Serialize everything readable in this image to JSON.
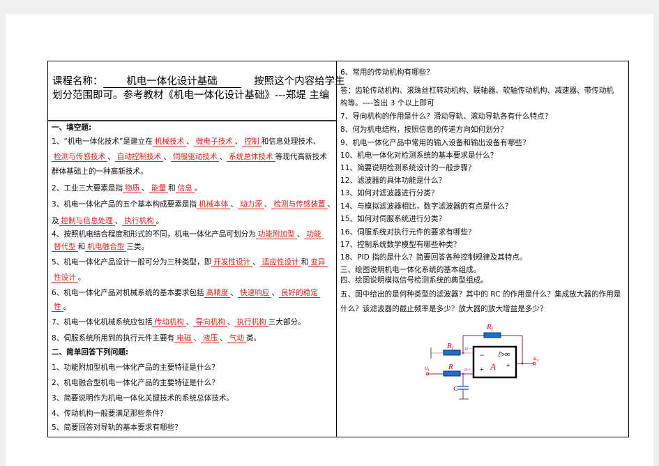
{
  "header": {
    "label": "课程名称：",
    "course": "机电一体化设计基础",
    "line1_tail": "按照这个内容给学生",
    "line2": "划分范围即可。参考教材《机电一体化设计基础》---郑堤  主编"
  },
  "left_lines": [
    [
      {
        "t": "一、填空题:",
        "bold": true
      }
    ],
    [
      {
        "t": "1、“机电一体化技术”是建立在"
      },
      {
        "t": "机械技术",
        "blank": true
      },
      {
        "t": "、"
      },
      {
        "t": "微电子技术",
        "blank": true
      },
      {
        "t": "、"
      },
      {
        "t": "控制",
        "blank": true
      },
      {
        "t": "和信息处理技术、"
      }
    ],
    [
      {
        "t": "检测与传感技术",
        "blank": true
      },
      {
        "t": "、"
      },
      {
        "t": "自动控制技术",
        "blank": true
      },
      {
        "t": "、"
      },
      {
        "t": "伺服驱动技术",
        "blank": true
      },
      {
        "t": "、"
      },
      {
        "t": "系统总体技术",
        "blank": true
      },
      {
        "t": "等现代高新技术"
      }
    ],
    [
      {
        "t": "群体基础上的一种高新技术。"
      }
    ],
    [
      {
        "t": "2、工业三大要素是指"
      },
      {
        "t": "物质",
        "blank": true
      },
      {
        "t": "、"
      },
      {
        "t": "能量",
        "blank": true
      },
      {
        "t": "和"
      },
      {
        "t": "信息",
        "blank": true
      },
      {
        "t": "。"
      }
    ],
    [
      {
        "t": "3、机电一体化产品的五个基本构成要素是指"
      },
      {
        "t": "机械本体",
        "blank": true
      },
      {
        "t": "、"
      },
      {
        "t": "动力源",
        "blank": true
      },
      {
        "t": "、"
      },
      {
        "t": "检测与传感装置",
        "blank": true
      },
      {
        "t": "、"
      }
    ],
    [
      {
        "t": "及"
      },
      {
        "t": "控制与信息处理",
        "blank": true
      },
      {
        "t": "、"
      },
      {
        "t": "执行机构",
        "blank": true
      },
      {
        "t": "。"
      }
    ],
    [
      {
        "t": "4、按照机电结合程度和形式的不同，机电一体化产品可划分为"
      },
      {
        "t": "功能附加型",
        "blank": true
      },
      {
        "t": "、"
      },
      {
        "t": "功能",
        "blank": true
      }
    ],
    [
      {
        "t": "替代型",
        "blank": true
      },
      {
        "t": "和"
      },
      {
        "t": "机电融合型",
        "blank": true
      },
      {
        "t": "三类。"
      }
    ],
    [
      {
        "t": "5、机电一体化产品设计一般可分为三种类型，即"
      },
      {
        "t": "开发性设计",
        "blank": true
      },
      {
        "t": "、"
      },
      {
        "t": "适应性设计",
        "blank": true
      },
      {
        "t": "和"
      },
      {
        "t": "变异",
        "blank": true
      }
    ],
    [
      {
        "t": "性设计",
        "blank": true
      },
      {
        "t": "。"
      }
    ],
    [
      {
        "t": "6、机电一体化产品对机械系统的基本要求包括"
      },
      {
        "t": "高精度",
        "blank": true
      },
      {
        "t": "、"
      },
      {
        "t": "快速响应",
        "blank": true
      },
      {
        "t": "、"
      },
      {
        "t": "良好的稳定",
        "blank": true
      }
    ],
    [
      {
        "t": "性",
        "blank": true
      },
      {
        "t": "。"
      }
    ],
    [
      {
        "t": "7、机电一体化机械系统应包括"
      },
      {
        "t": "传动机构",
        "blank": true
      },
      {
        "t": "、"
      },
      {
        "t": "导向机构",
        "blank": true
      },
      {
        "t": "、"
      },
      {
        "t": "执行机构",
        "blank": true
      },
      {
        "t": "三大部分。"
      }
    ],
    [
      {
        "t": "8、伺服系统所用到的执行元件主要有"
      },
      {
        "t": "电磁",
        "blank": true
      },
      {
        "t": "、"
      },
      {
        "t": "液压",
        "blank": true
      },
      {
        "t": "、"
      },
      {
        "t": "气动",
        "blank": true
      },
      {
        "t": "类。"
      }
    ],
    [
      {
        "t": "二、简单回答下列问题:",
        "bold": true
      }
    ],
    [
      {
        "t": "1、功能附加型机电一体化产品的主要特征是什么？"
      }
    ],
    [
      {
        "t": "2、机电融合型机电一体化产品的主要特征是什么？"
      }
    ],
    [
      {
        "t": "3、简要说明作为机电一体化关键技术的系统总体技术。"
      }
    ],
    [
      {
        "t": "4、传动机构一般要满足那些条件？"
      }
    ],
    [
      {
        "t": "5、简要回答对导轨的基本要求有哪些？"
      }
    ]
  ],
  "right_lines": [
    [
      {
        "t": "6、常用的传动机构有哪些？"
      }
    ],
    [
      {
        "t": "答：齿轮传动机构、滚珠丝杠转动机构、联轴器、软轴传动机构、减速器、带传动机"
      }
    ],
    [
      {
        "t": "构等。----答出 3 个以上即可"
      }
    ],
    [
      {
        "t": "7、导向机构的作用是什么？滑动导轨、滚动导轨各有什么特点？"
      }
    ],
    [
      {
        "t": "8、何为机电结构，按照信息的传递方向如何划分？"
      }
    ],
    [
      {
        "t": "9、机电一体化产品中常用的输入设备和输出设备有哪些？"
      }
    ],
    [
      {
        "t": "10、机电一体化对检测系统的基本要求是什么？"
      }
    ],
    [
      {
        "t": "11、简要说明检测系统设计的一般步骤？"
      }
    ],
    [
      {
        "t": "12、滤波器的具体功能是什么？"
      }
    ],
    [
      {
        "t": "13、如何对滤波器进行分类？"
      }
    ],
    [
      {
        "t": "14、与模拟滤波器相比，数字滤波器的有点是什么？"
      }
    ],
    [
      {
        "t": "15、如何对伺服系统进行分类？"
      }
    ],
    [
      {
        "t": "16、伺服系统对执行元件的要求有哪些？"
      }
    ],
    [
      {
        "t": "17、控制系统数学模型有哪些种类？"
      }
    ],
    [
      {
        "t": "18、PID 指的是什么？简要回答各种控制规律及其特点。"
      }
    ],
    [
      {
        "t": "三、绘图说明机电一体化系统的基本组成。"
      }
    ],
    [
      {
        "t": "四、绘图说明模拟信号检测系统的典型组成。"
      }
    ],
    [
      {
        "t": "五、图中给出的是何种类型的滤波器？其中的 RC 的作用是什么？集成放大器的作用是"
      }
    ],
    [
      {
        "t": "什么？该滤波器的截止频率是多少？放大器的放大增益是多少？"
      }
    ]
  ],
  "circuit": {
    "rf": "R",
    "rf_sub": "f",
    "r1": "R",
    "r1_sub": "1",
    "r": "R",
    "c": "C",
    "u_minus": "u−",
    "u_plus": "u+",
    "ui": "u",
    "ui_sub": "i",
    "uo": "u",
    "uo_sub": "o",
    "amp": "A",
    "inf": "▷∞",
    "minus": "−",
    "plus": "+",
    "out_plus": "+"
  },
  "colors": {
    "answer": "#e0201c",
    "wire": "#8b2252",
    "resistor": "#1e6fd0"
  }
}
